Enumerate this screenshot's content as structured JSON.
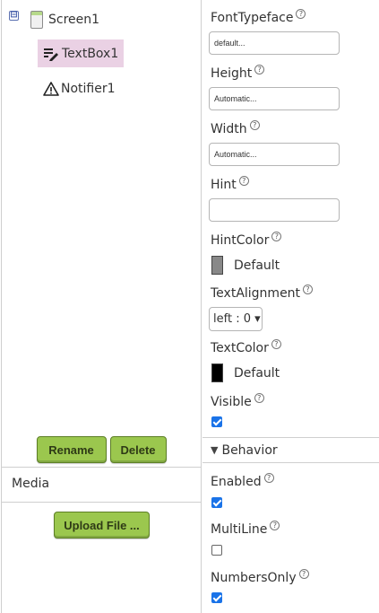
{
  "components_tree": {
    "collapse_glyph": "⊟",
    "screen": "Screen1",
    "children": [
      {
        "label": "TextBox1",
        "icon": "textbox-icon",
        "selected": true
      },
      {
        "label": "Notifier1",
        "icon": "warning-icon",
        "selected": false
      }
    ]
  },
  "component_actions": {
    "rename": "Rename",
    "delete": "Delete"
  },
  "media": {
    "title": "Media",
    "upload": "Upload File ..."
  },
  "help_glyph": "?",
  "properties": {
    "font_typeface": {
      "label": "FontTypeface",
      "value": "default..."
    },
    "height": {
      "label": "Height",
      "value": "Automatic..."
    },
    "width": {
      "label": "Width",
      "value": "Automatic..."
    },
    "hint": {
      "label": "Hint",
      "value": ""
    },
    "hint_color": {
      "label": "HintColor",
      "value": "Default",
      "swatch": "#888888"
    },
    "text_alignment": {
      "label": "TextAlignment",
      "value": "left : 0 ▾"
    },
    "text_color": {
      "label": "TextColor",
      "value": "Default",
      "swatch": "#000000"
    },
    "visible": {
      "label": "Visible",
      "checked": true
    }
  },
  "behavior": {
    "title": "Behavior",
    "enabled": {
      "label": "Enabled",
      "checked": true
    },
    "multiline": {
      "label": "MultiLine",
      "checked": false
    },
    "numbers_only": {
      "label": "NumbersOnly",
      "checked": true
    }
  },
  "colors": {
    "button_green": "#9bc74e",
    "selection": "#ead1e4",
    "checkbox_blue": "#1a73e8"
  }
}
